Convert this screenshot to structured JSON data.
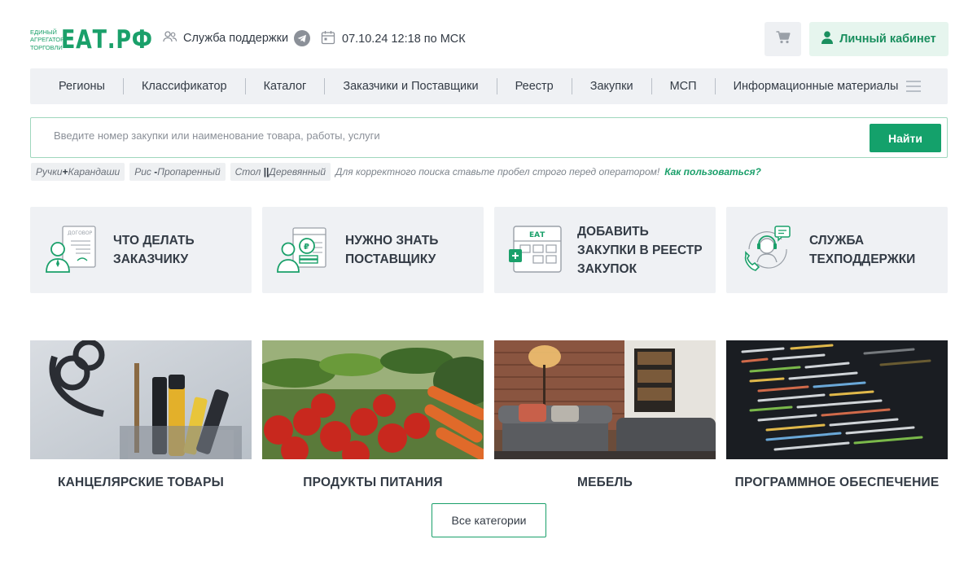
{
  "header": {
    "logo_small_lines": [
      "Единый",
      "агрегатор",
      "торговли"
    ],
    "logo_text": "ЕАТ.РФ",
    "support_label": "Служба поддержки",
    "datetime": "07.10.24 12:18 по МСК",
    "cabinet_label": "Личный кабинет"
  },
  "nav": {
    "items": [
      {
        "label": "Регионы"
      },
      {
        "label": "Классификатор"
      },
      {
        "label": "Каталог"
      },
      {
        "label": "Заказчики и Поставщики"
      },
      {
        "label": "Реестр"
      },
      {
        "label": "Закупки"
      },
      {
        "label": "МСП"
      },
      {
        "label": "Информационные материалы"
      }
    ]
  },
  "search": {
    "placeholder": "Введите номер закупки или наименование товара, работы, услуги",
    "button_label": "Найти"
  },
  "hints": {
    "chips": [
      {
        "left": "Ручки",
        "op": "+",
        "right": "Карандаши"
      },
      {
        "left": "Рис",
        "op": "-",
        "right": "Пропаренный"
      },
      {
        "left": "Стол",
        "op": "||",
        "right": "Деревянный"
      }
    ],
    "note": "Для корректного поиска ставьте пробел строго перед оператором!",
    "link": "Как пользоваться?"
  },
  "features": [
    {
      "line1": "Что делать",
      "line2": "заказчику",
      "icon_doc": "ДОГОВОР"
    },
    {
      "line1": "Нужно знать",
      "line2": "поставщику"
    },
    {
      "line1": "Добавить",
      "line2": "закупки в реестр",
      "line3": "закупок",
      "icon_text": "ЕАТ"
    },
    {
      "line1": "Служба",
      "line2": "техподдержки"
    }
  ],
  "categories": [
    {
      "label": "Канцелярские товары"
    },
    {
      "label": "Продукты питания"
    },
    {
      "label": "Мебель"
    },
    {
      "label": "Программное обеспечение"
    }
  ],
  "all_categories_label": "Все категории",
  "colors": {
    "brand": "#1aa06a",
    "button": "#14a16b",
    "panel": "#eff1f4"
  }
}
